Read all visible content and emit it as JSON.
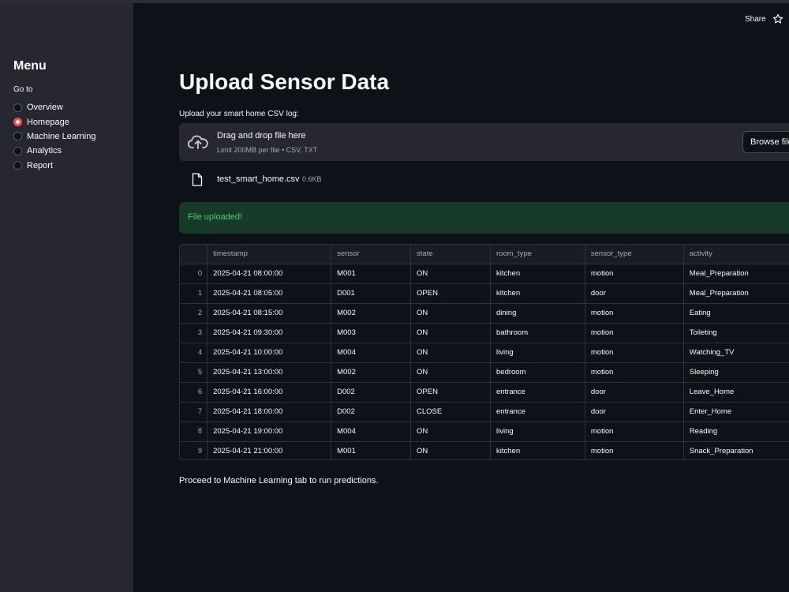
{
  "sidebar": {
    "title": "Menu",
    "goto_label": "Go to",
    "options": [
      {
        "label": "Overview",
        "selected": false
      },
      {
        "label": "Homepage",
        "selected": true
      },
      {
        "label": "Machine Learning",
        "selected": false
      },
      {
        "label": "Analytics",
        "selected": false
      },
      {
        "label": "Report",
        "selected": false
      }
    ]
  },
  "header": {
    "share_label": "Share",
    "star_icon": "star-icon"
  },
  "main": {
    "title": "Upload Sensor Data",
    "uploader": {
      "label": "Upload your smart home CSV log:",
      "drop_title": "Drag and drop file here",
      "drop_subtitle": "Limit 200MB per file • CSV, TXT",
      "browse_label": "Browse files",
      "icon": "cloud-upload-icon"
    },
    "file": {
      "name": "test_smart_home.csv",
      "size": "0.6KB",
      "icon": "file-icon"
    },
    "success_message": "File uploaded!",
    "footer_text": "Proceed to Machine Learning tab to run predictions."
  },
  "table": {
    "columns": [
      "timestamp",
      "sensor",
      "state",
      "room_type",
      "sensor_type",
      "activity"
    ],
    "rows": [
      {
        "index": "0",
        "cells": [
          "2025-04-21 08:00:00",
          "M001",
          "ON",
          "kitchen",
          "motion",
          "Meal_Preparation"
        ]
      },
      {
        "index": "1",
        "cells": [
          "2025-04-21 08:05:00",
          "D001",
          "OPEN",
          "kitchen",
          "door",
          "Meal_Preparation"
        ]
      },
      {
        "index": "2",
        "cells": [
          "2025-04-21 08:15:00",
          "M002",
          "ON",
          "dining",
          "motion",
          "Eating"
        ]
      },
      {
        "index": "3",
        "cells": [
          "2025-04-21 09:30:00",
          "M003",
          "ON",
          "bathroom",
          "motion",
          "Toileting"
        ]
      },
      {
        "index": "4",
        "cells": [
          "2025-04-21 10:00:00",
          "M004",
          "ON",
          "living",
          "motion",
          "Watching_TV"
        ]
      },
      {
        "index": "5",
        "cells": [
          "2025-04-21 13:00:00",
          "M002",
          "ON",
          "bedroom",
          "motion",
          "Sleeping"
        ]
      },
      {
        "index": "6",
        "cells": [
          "2025-04-21 16:00:00",
          "D002",
          "OPEN",
          "entrance",
          "door",
          "Leave_Home"
        ]
      },
      {
        "index": "7",
        "cells": [
          "2025-04-21 18:00:00",
          "D002",
          "CLOSE",
          "entrance",
          "door",
          "Enter_Home"
        ]
      },
      {
        "index": "8",
        "cells": [
          "2025-04-21 19:00:00",
          "M004",
          "ON",
          "living",
          "motion",
          "Reading"
        ]
      },
      {
        "index": "9",
        "cells": [
          "2025-04-21 21:00:00",
          "M001",
          "ON",
          "kitchen",
          "motion",
          "Snack_Preparation"
        ]
      }
    ]
  },
  "colors": {
    "background": "#0e1117",
    "sidebar": "#262730",
    "accent": "#ff4b4b",
    "success_bg": "#173928",
    "success_text": "#3dd56d"
  }
}
